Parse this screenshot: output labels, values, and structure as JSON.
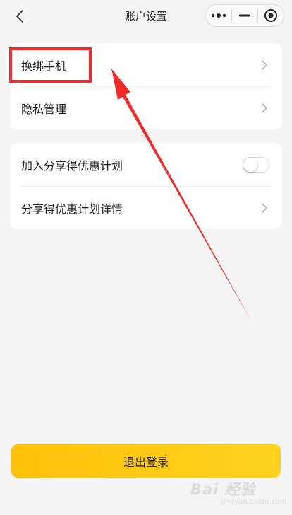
{
  "header": {
    "title": "账户设置",
    "back_icon": "chevron-left-icon",
    "capsule_icons": [
      "more-dots-icon",
      "minimize-icon",
      "close-target-icon"
    ]
  },
  "card1": {
    "items": [
      {
        "label": "换绑手机",
        "icon": "chevron-right-icon"
      },
      {
        "label": "隐私管理",
        "icon": "chevron-right-icon"
      }
    ]
  },
  "card2": {
    "items": [
      {
        "label": "加入分享得优惠计划",
        "control": "toggle",
        "toggle_on": false
      },
      {
        "label": "分享得优惠计划详情",
        "icon": "chevron-right-icon"
      }
    ]
  },
  "logout": {
    "label": "退出登录"
  },
  "annotation": {
    "color": "#ee2c2c"
  },
  "watermark": {
    "logo": "Bai 经验",
    "sub": "jingyan.baidu.com"
  },
  "colors": {
    "background": "#f4f4f4",
    "card": "#ffffff",
    "button_start": "#ffc10a",
    "button_end": "#ffd21f",
    "chevron": "#b4b4b4"
  }
}
